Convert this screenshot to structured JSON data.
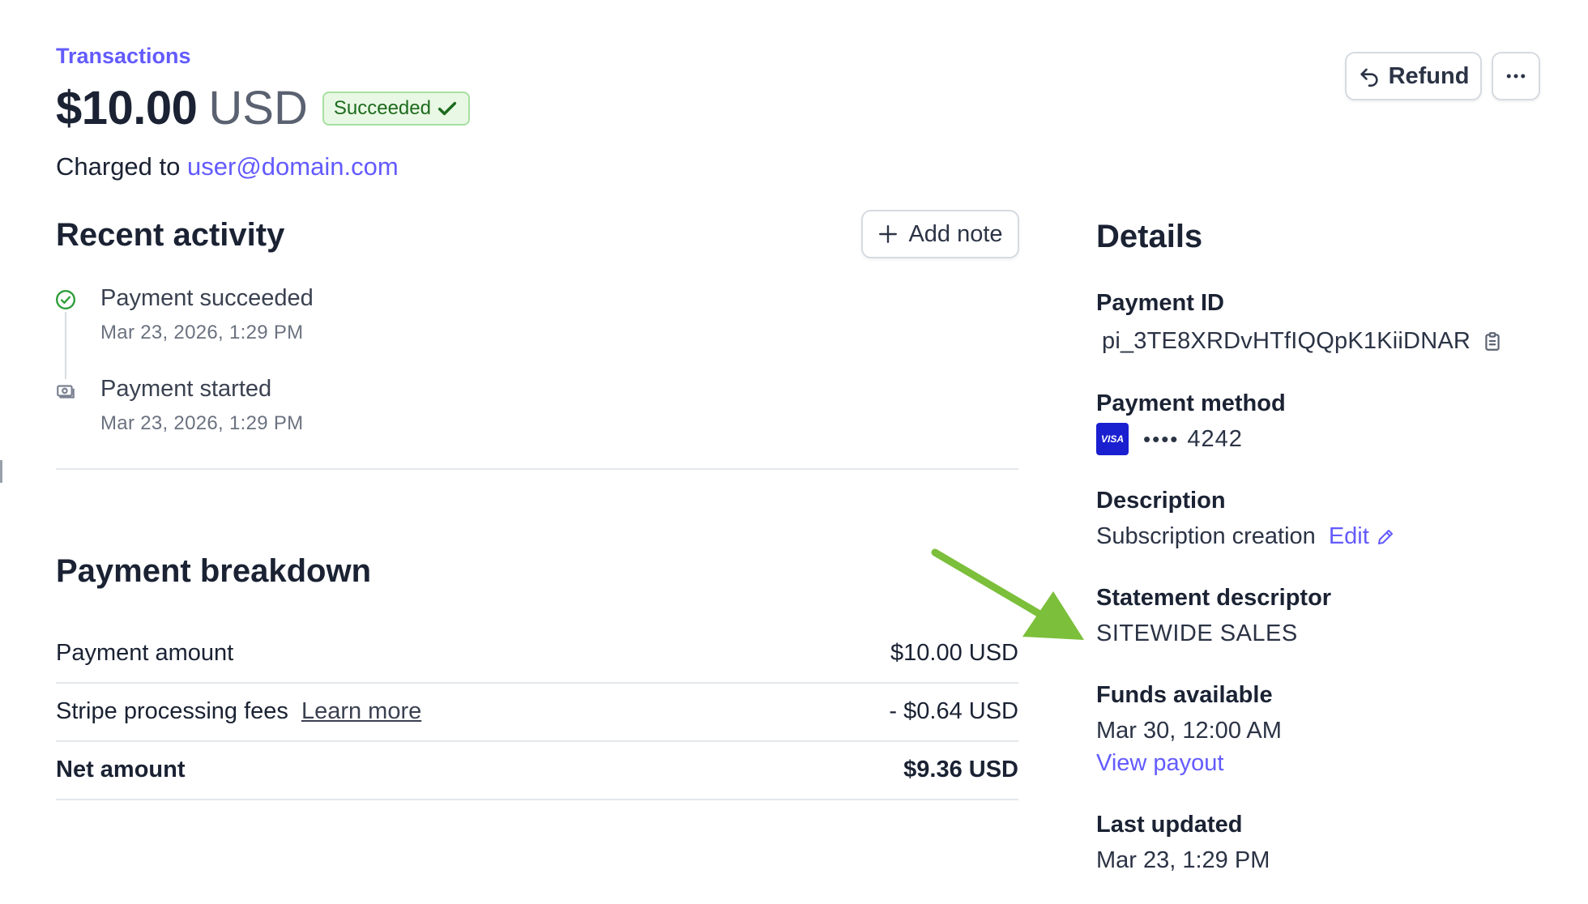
{
  "header": {
    "breadcrumb": "Transactions",
    "amount": "$10.00",
    "currency": "USD",
    "status": "Succeeded",
    "charged_prefix": "Charged to",
    "charged_email": "user@domain.com",
    "refund_label": "Refund",
    "more_icon": "ellipsis-icon"
  },
  "recent_activity": {
    "title": "Recent activity",
    "add_note_label": "Add note",
    "items": [
      {
        "title": "Payment succeeded",
        "date": "Mar 23, 2026, 1:29 PM",
        "icon": "check-circle-icon"
      },
      {
        "title": "Payment started",
        "date": "Mar 23, 2026, 1:29 PM",
        "icon": "cash-icon"
      }
    ]
  },
  "breakdown": {
    "title": "Payment breakdown",
    "rows": [
      {
        "label": "Payment amount",
        "value": "$10.00 USD"
      },
      {
        "label": "Stripe processing fees",
        "link": "Learn more",
        "value": "- $0.64 USD"
      },
      {
        "label": "Net amount",
        "value": "$9.36 USD"
      }
    ]
  },
  "details": {
    "title": "Details",
    "payment_id_label": "Payment ID",
    "payment_id": "pi_3TE8XRDvHTfIQQpK1KiiDNAR",
    "payment_method_label": "Payment method",
    "card_brand": "VISA",
    "card_dots": "••••",
    "card_last4": "4242",
    "description_label": "Description",
    "description": "Subscription creation",
    "edit_label": "Edit",
    "statement_descriptor_label": "Statement descriptor",
    "statement_descriptor": "SITEWIDE SALES",
    "funds_available_label": "Funds available",
    "funds_available": "Mar 30, 12:00 AM",
    "view_payout_label": "View payout",
    "last_updated_label": "Last updated",
    "last_updated": "Mar 23, 1:29 PM"
  },
  "colors": {
    "accent": "#635bff",
    "success": "#1d6b1d",
    "annotation_arrow": "#7bbf3a"
  }
}
